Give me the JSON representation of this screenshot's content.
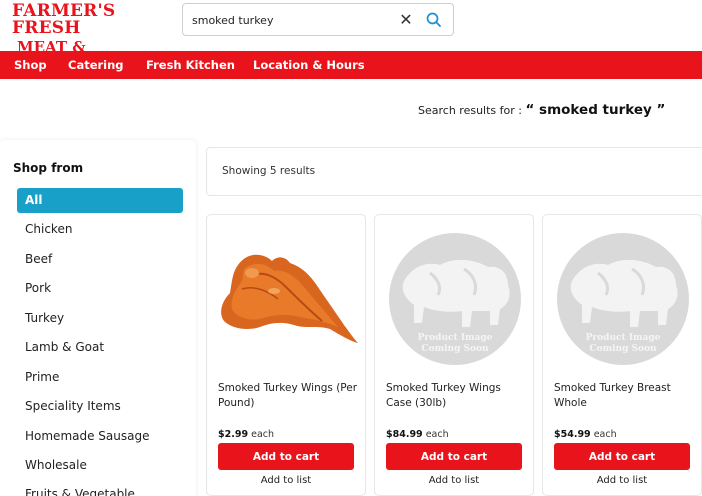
{
  "brand": {
    "logo_line1": "Farmer's Fresh",
    "logo_line2": "Meat & Grocery",
    "color": "#e8131b"
  },
  "search": {
    "value": "smoked turkey",
    "clear_icon": "x-icon",
    "search_icon": "magnifier-icon"
  },
  "nav": [
    "Shop",
    "Catering",
    "Fresh Kitchen",
    "Location & Hours"
  ],
  "results_header": {
    "prefix": "Search results for :",
    "query": "“ smoked turkey ”"
  },
  "sidebar": {
    "title": "Shop from",
    "accent": "#19a0c9",
    "items": [
      "All",
      "Chicken",
      "Beef",
      "Pork",
      "Turkey",
      "Lamb & Goat",
      "Prime",
      "Speciality Items",
      "Homemade Sausage",
      "Wholesale",
      "Fruits & Vegetable"
    ]
  },
  "results": {
    "showing": "Showing 5 results"
  },
  "products": [
    {
      "name": "Smoked Turkey Wings (Per Pound)",
      "price": "$2.99",
      "unit": "each",
      "image": "turkey-wing-photo",
      "cart_label": "Add to cart",
      "list_label": "Add to list"
    },
    {
      "name": "Smoked Turkey Wings Case (30lb)",
      "price": "$84.99",
      "unit": "each",
      "image": "placeholder",
      "placeholder_line1": "Product Image",
      "placeholder_line2": "Coming Soon",
      "cart_label": "Add to cart",
      "list_label": "Add to list"
    },
    {
      "name": "Smoked Turkey Breast Whole",
      "price": "$54.99",
      "unit": "each",
      "image": "placeholder",
      "placeholder_line1": "Product Image",
      "placeholder_line2": "Coming Soon",
      "cart_label": "Add to cart",
      "list_label": "Add to list"
    }
  ]
}
